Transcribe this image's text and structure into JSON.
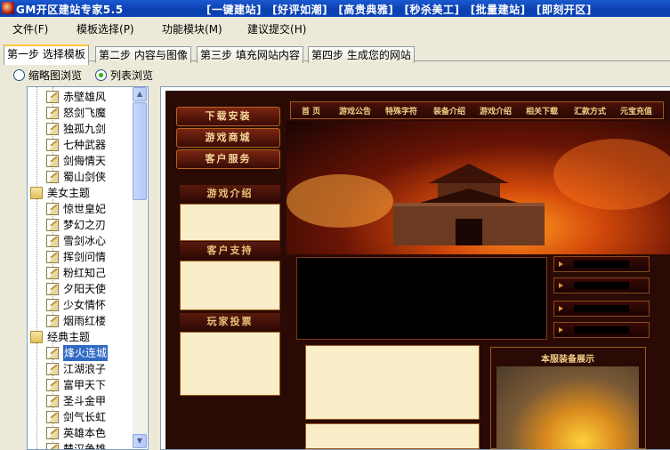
{
  "titlebar": {
    "app_title": "GM开区建站专家5.5",
    "links": [
      "[一键建站]",
      "[好评如潮]",
      "[高贵典雅]",
      "[秒杀美工]",
      "[批量建站]",
      "[即刻开区]"
    ]
  },
  "menubar": [
    {
      "label": "文件",
      "key": "(F)"
    },
    {
      "label": "模板选择",
      "key": "(P)"
    },
    {
      "label": "功能模块",
      "key": "(M)"
    },
    {
      "label": "建议提交",
      "key": "(H)"
    }
  ],
  "tabs": [
    "第一步 选择模板",
    "第二步 内容与图像",
    "第三步 填充网站内容",
    "第四步 生成您的网站"
  ],
  "view_options": {
    "thumbnail": "缩略图浏览",
    "list": "列表浏览",
    "selected": "list"
  },
  "tree": {
    "items_a": [
      "赤壁雄风",
      "怒剑飞魔",
      "独孤九剑",
      "七种武器",
      "剑侮情天",
      "蜀山剑侠"
    ],
    "folder_b": "美女主题",
    "items_b": [
      "惊世皇妃",
      "梦幻之刃",
      "雪剑冰心",
      "挥剑问情",
      "粉红知己",
      "夕阳天使",
      "少女情怀",
      "烟雨红楼"
    ],
    "folder_c": "经典主题",
    "items_c": [
      "烽火连城",
      "江湖浪子",
      "富甲天下",
      "圣斗金甲",
      "剑气长虹",
      "英雄本色",
      "楚汉争雄"
    ],
    "selected": "烽火连城"
  },
  "preview": {
    "left_buttons": [
      "下载安装",
      "游戏商城",
      "客户服务"
    ],
    "left_sections": [
      "游戏介绍",
      "客户支持",
      "玩家投票"
    ],
    "nav": [
      "首 页",
      "游戏公告",
      "特殊字符",
      "装备介绍",
      "游戏介绍",
      "相关下载",
      "汇款方式",
      "元宝充值"
    ],
    "equip_title": "本服装备展示"
  },
  "colors": {
    "titlebar": "#0a3fb0",
    "tab_active_top": "#ffc83c",
    "selection": "#316ac5",
    "site_bg": "#2a0a04",
    "gold_text": "#f1cf87"
  }
}
